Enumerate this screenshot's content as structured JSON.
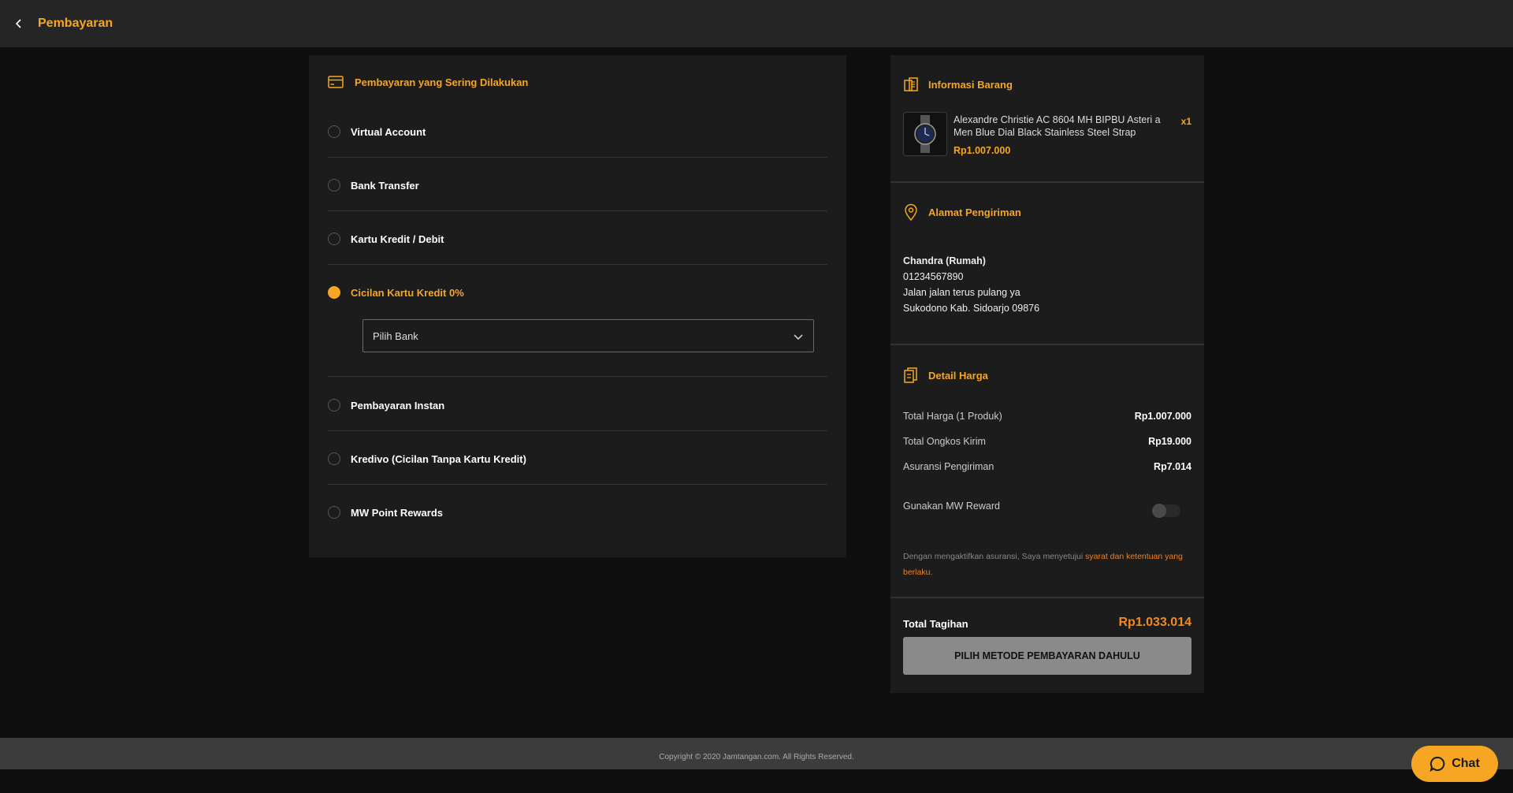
{
  "header": {
    "title": "Pembayaran"
  },
  "payment": {
    "section_title": "Pembayaran yang Sering Dilakukan",
    "methods": [
      {
        "label": "Virtual Account",
        "selected": false
      },
      {
        "label": "Bank Transfer",
        "selected": false
      },
      {
        "label": "Kartu Kredit / Debit",
        "selected": false
      },
      {
        "label": "Cicilan Kartu Kredit 0%",
        "selected": true
      },
      {
        "label": "Pembayaran Instan",
        "selected": false
      },
      {
        "label": "Kredivo (Cicilan Tanpa Kartu Kredit)",
        "selected": false
      },
      {
        "label": "MW Point Rewards",
        "selected": false
      }
    ],
    "bank_select_placeholder": "Pilih Bank"
  },
  "item_info": {
    "title": "Informasi Barang",
    "product_name": "Alexandre Christie AC 8604 MH BIPBU Asteri a Men Blue Dial Black Stainless Steel Strap",
    "price": "Rp1.007.000",
    "qty": "x1"
  },
  "shipping": {
    "title": "Alamat Pengiriman",
    "name": "Chandra (Rumah)",
    "phone": "01234567890",
    "street": "Jalan jalan terus pulang ya",
    "city": "Sukodono Kab. Sidoarjo 09876"
  },
  "price_detail": {
    "title": "Detail Harga",
    "rows": [
      {
        "label": "Total Harga (1 Produk)",
        "value": "Rp1.007.000"
      },
      {
        "label": "Total Ongkos Kirim",
        "value": "Rp19.000"
      },
      {
        "label": "Asuransi Pengiriman",
        "value": "Rp7.014"
      }
    ],
    "reward_label": "Gunakan MW Reward",
    "reward_enabled": false,
    "disclaimer_text": "Dengan mengaktifkan asuransi, Saya menyetujui ",
    "disclaimer_link": "syarat dan ketentuan yang berlaku.",
    "total_label": "Total Tagihan",
    "total_value": "Rp1.033.014",
    "pay_button": "PILIH METODE PEMBAYARAN DAHULU"
  },
  "footer": {
    "copyright": "Copyright © 2020 Jamtangan.com. All Rights Reserved."
  },
  "chat": {
    "label": "Chat"
  },
  "colors": {
    "accent": "#f6a623",
    "accent_total": "#f08a24",
    "background": "#0f0f0f",
    "panel": "#1c1c1c"
  }
}
